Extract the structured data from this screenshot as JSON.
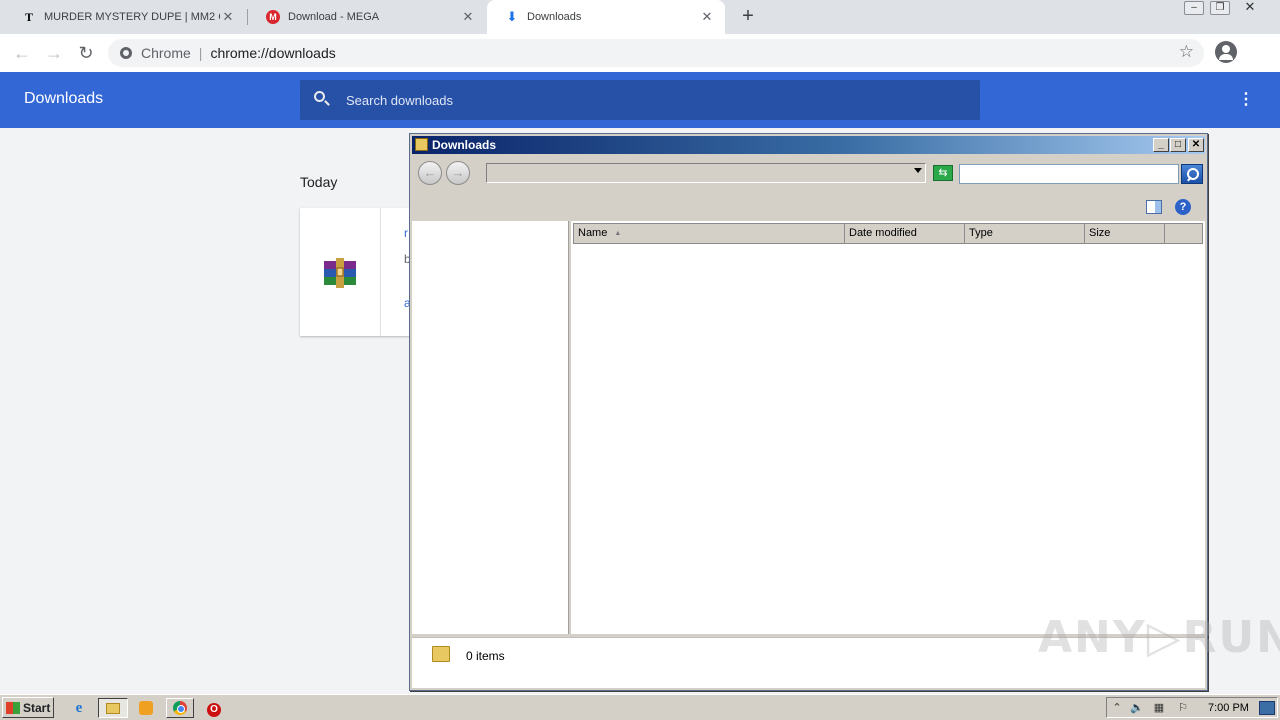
{
  "browser": {
    "tabs": [
      {
        "title": "MURDER MYSTERY DUPE | MM2 CHE",
        "favicon": "t-favicon-icon",
        "active": false
      },
      {
        "title": "Download - MEGA",
        "favicon": "mega-icon",
        "active": false
      },
      {
        "title": "Downloads",
        "favicon": "download-icon",
        "active": true
      }
    ],
    "omnibox": {
      "site_label": "Chrome",
      "divider": "|",
      "url": "chrome://downloads"
    }
  },
  "downloads_page": {
    "title": "Downloads",
    "search_placeholder": "Search downloads",
    "section_label": "Today",
    "item_fragments": [
      "r",
      "b",
      "a"
    ],
    "accent_color": "#3367d6"
  },
  "explorer": {
    "title": "Downloads",
    "address": "",
    "columns": [
      "Name",
      "Date modified",
      "Type",
      "Size"
    ],
    "sorted_column": "Name",
    "status": "0 items"
  },
  "taskbar": {
    "start_label": "Start",
    "clock": "7:00 PM"
  },
  "watermark": "ANY RUN"
}
